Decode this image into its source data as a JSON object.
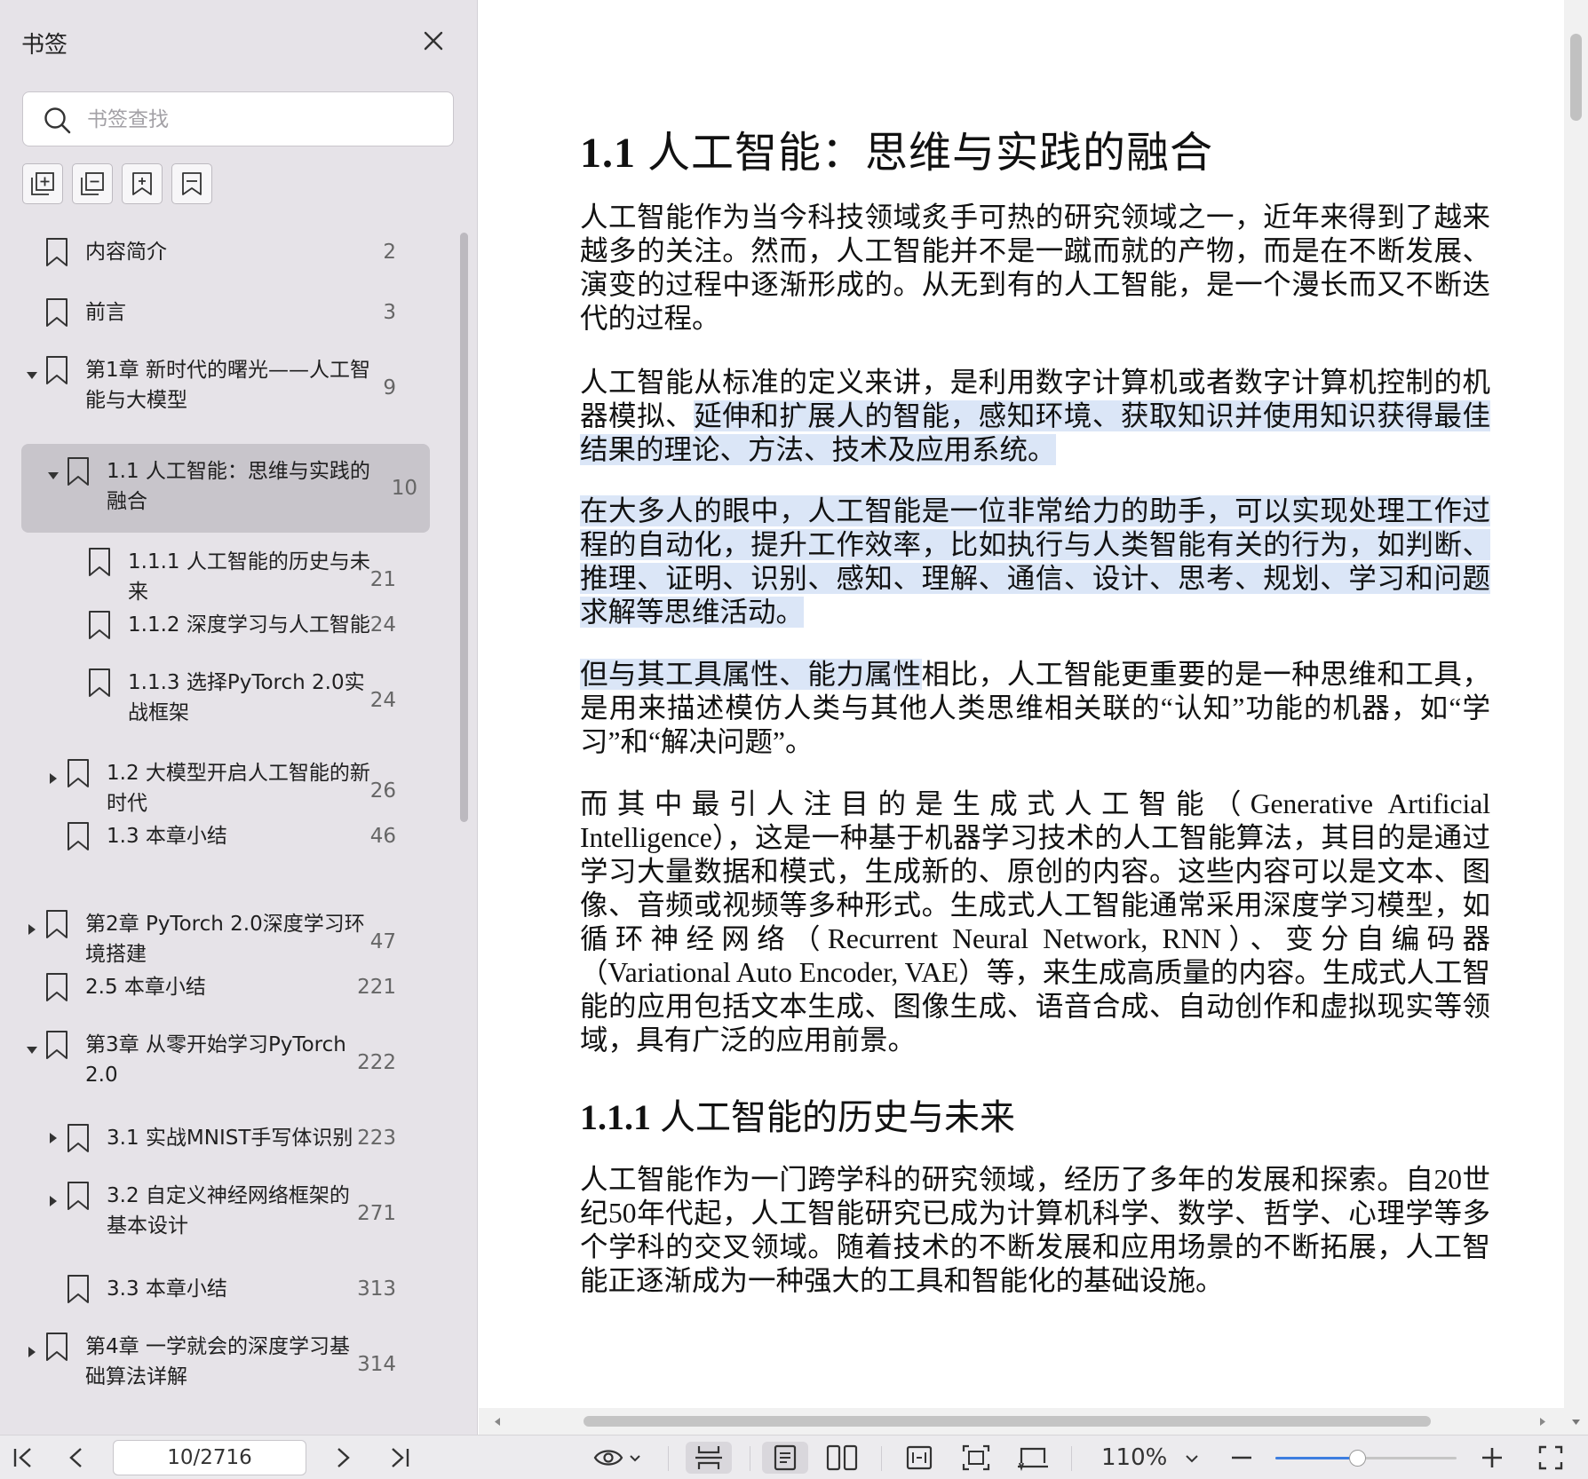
{
  "sidebar": {
    "title": "书签",
    "search_placeholder": "书签查找",
    "tools": [
      "expand-all-icon",
      "collapse-all-icon",
      "add-bookmark-icon",
      "bookmark-icon"
    ],
    "items": [
      {
        "label_lines": [
          "内容简介"
        ],
        "page": "2",
        "level": 0,
        "twisty": "none"
      },
      {
        "label_lines": [
          "前言"
        ],
        "page": "3",
        "level": 0,
        "twisty": "none"
      },
      {
        "label_lines": [
          "第1章 新时代的曙光——人工智",
          "能与大模型"
        ],
        "page": "9",
        "level": 0,
        "twisty": "expanded"
      },
      {
        "label_lines": [
          "1.1 人工智能：思维与实践的",
          "融合"
        ],
        "page": "10",
        "level": 1,
        "twisty": "expanded",
        "selected": true
      },
      {
        "label_lines": [
          "1.1.1 人工智能的历史与未",
          "来"
        ],
        "page": "21",
        "level": 2,
        "twisty": "none"
      },
      {
        "label_lines": [
          "1.1.2 深度学习与人工智能"
        ],
        "page": "24",
        "level": 2,
        "twisty": "none"
      },
      {
        "label_lines": [
          "1.1.3 选择PyTorch 2.0实",
          "战框架"
        ],
        "page": "24",
        "level": 2,
        "twisty": "none"
      },
      {
        "label_lines": [
          "1.2 大模型开启人工智能的新",
          "时代"
        ],
        "page": "26",
        "level": 1,
        "twisty": "collapsed"
      },
      {
        "label_lines": [
          "1.3 本章小结"
        ],
        "page": "46",
        "level": 1,
        "twisty": "none"
      },
      {
        "label_lines": [
          "第2章 PyTorch 2.0深度学习环",
          "境搭建"
        ],
        "page": "47",
        "level": 0,
        "twisty": "collapsed"
      },
      {
        "label_lines": [
          "2.5 本章小结"
        ],
        "page": "221",
        "level": 0,
        "twisty": "none"
      },
      {
        "label_lines": [
          "第3章 从零开始学习PyTorch",
          "2.0"
        ],
        "page": "222",
        "level": 0,
        "twisty": "expanded"
      },
      {
        "label_lines": [
          "3.1 实战MNIST手写体识别"
        ],
        "page": "223",
        "level": 1,
        "twisty": "collapsed"
      },
      {
        "label_lines": [
          "3.2 自定义神经网络框架的",
          "基本设计"
        ],
        "page": "271",
        "level": 1,
        "twisty": "collapsed"
      },
      {
        "label_lines": [
          "3.3 本章小结"
        ],
        "page": "313",
        "level": 1,
        "twisty": "none"
      },
      {
        "label_lines": [
          "第4章 一学就会的深度学习基",
          "础算法详解"
        ],
        "page": "314",
        "level": 0,
        "twisty": "collapsed"
      }
    ]
  },
  "document": {
    "heading1_num": "1.1",
    "heading1_text": "人工智能：思维与实践的融合",
    "paragraphs": [
      [
        {
          "t": "人工智能作为当今科技领域炙手可热的研究领域之一，近年来得到了越来越多的关注。然而，人工智能并不是一蹴而就的产物，而是在不断发展、演变的过程中逐渐形成的。从无到有的人工智能，是一个漫长而又不断迭代的过程。",
          "hl": false
        }
      ],
      [
        {
          "t": "人工智能从标准的定义来讲，是利用数字计算机或者数字计算机控制的机器模拟、",
          "hl": false
        },
        {
          "t": "延伸和扩展人的智能，感知环境、获取知识并使用知识获得最佳结果的理论、方法、技术及应用系统。",
          "hl": true
        }
      ],
      [
        {
          "t": "在大多人的眼中，人工智能是一位非常给力的助手，可以实现处理工作过程的自动化，提升工作效率，比如执行与人类智能有关的行为，如判断、推理、证明、识别、感知、理解、通信、设计、思考、规划、学习和问题求解等思维活动。",
          "hl": true
        }
      ],
      [
        {
          "t": "但与其工具属性、能力属性",
          "hl": true
        },
        {
          "t": "相比，人工智能更重要的是一种思维和工具，是用来描述模仿人类与其他人类思维相关联的“认知”功能的机器，如“学习”和“解决问题”。",
          "hl": false
        }
      ],
      [
        {
          "t": "而其中最引人注目的是生成式人工智能（Generative Artificial Intelligence），这是一种基于机器学习技术的人工智能算法，其目的是通过学习大量数据和模式，生成新的、原创的内容。这些内容可以是文本、图像、音频或视频等多种形式。生成式人工智能通常采用深度学习模型，如循环神经网络（Recurrent Neural Network, RNN）、变分自编码器（Variational Auto Encoder, VAE）等，来生成高质量的内容。生成式人工智能的应用包括文本生成、图像生成、语音合成、自动创作和虚拟现实等领域，具有广泛的应用前景。",
          "hl": false
        }
      ]
    ],
    "heading2_num": "1.1.1",
    "heading2_text": "人工智能的历史与未来",
    "paragraph_after": "人工智能作为一门跨学科的研究领域，经历了多年的发展和探索。自20世纪50年代起，人工智能研究已成为计算机科学、数学、哲学、心理学等多个学科的交叉领域。随着技术的不断发展和应用场景的不断拓展，人工智能正逐渐成为一种强大的工具和智能化的基础设施。"
  },
  "bottombar": {
    "page_indicator": "10/2716",
    "zoom": "110%",
    "zoom_slider_fraction": 0.45
  },
  "colors": {
    "highlight": "#dbe6f7",
    "sidebar_bg": "#e6e3e8",
    "selected_item": "#c8c5cb",
    "accent": "#3d7ee0"
  }
}
